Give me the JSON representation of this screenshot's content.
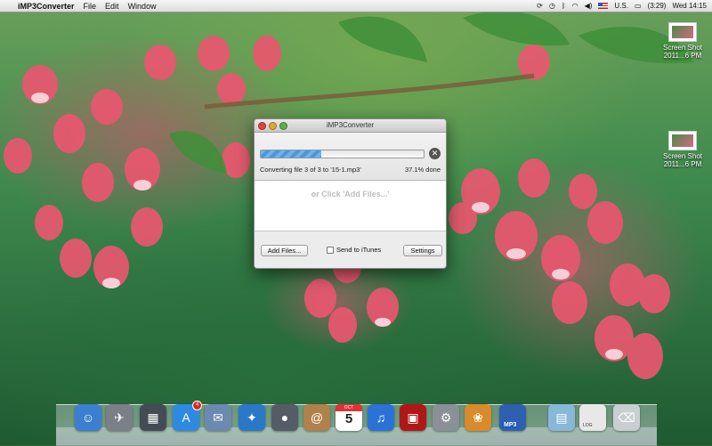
{
  "menubar": {
    "apple_icon": "apple-icon",
    "app_name": "iMP3Converter",
    "menus": [
      "File",
      "Edit",
      "Window"
    ],
    "battery": "(3:29)",
    "input_source": "U.S.",
    "clock": "Wed 14:15"
  },
  "desktop_icons": [
    {
      "label": "Screen Shot 2011...6 PM"
    },
    {
      "label": "Screen Shot 2011...6 PM"
    }
  ],
  "window": {
    "title": "iMP3Converter",
    "status": "Converting file 3 of 3 to '15-1.mp3'",
    "percent": "37.1% done",
    "progress_fraction": 0.371,
    "drop_hint": "or Click 'Add Files...'",
    "add_files_label": "Add Files...",
    "send_to_itunes_label": "Send to iTunes",
    "send_to_itunes_checked": false,
    "settings_label": "Settings"
  },
  "dock": {
    "items": [
      {
        "name": "finder-icon",
        "color": "#3a7fd0"
      },
      {
        "name": "launchpad-icon",
        "color": "#7a7f88"
      },
      {
        "name": "mission-control-icon",
        "color": "#444b55"
      },
      {
        "name": "app-store-icon",
        "color": "#2e8ae0",
        "badge": "4"
      },
      {
        "name": "mail-stamp-icon",
        "color": "#6a8ab0"
      },
      {
        "name": "safari-icon",
        "color": "#2b78c8"
      },
      {
        "name": "facetime-icon",
        "color": "#555c66"
      },
      {
        "name": "address-book-icon",
        "color": "#b0814a"
      },
      {
        "name": "calendar-icon",
        "color": "#ffffff",
        "month": "OCT",
        "day": "5"
      },
      {
        "name": "itunes-icon",
        "color": "#2a72d8"
      },
      {
        "name": "photo-booth-icon",
        "color": "#b01818"
      },
      {
        "name": "system-preferences-icon",
        "color": "#8b8f96"
      },
      {
        "name": "iphoto-icon",
        "color": "#d98a2a"
      },
      {
        "name": "imp3converter-icon",
        "color": "#2f5fb0",
        "label": "MP3"
      },
      {
        "name": "applications-folder-icon",
        "color": "#88b8d8"
      },
      {
        "name": "log-document-icon",
        "color": "#e8e8e8",
        "label": "LOG"
      },
      {
        "name": "trash-icon",
        "color": "#c9ced2"
      }
    ]
  }
}
